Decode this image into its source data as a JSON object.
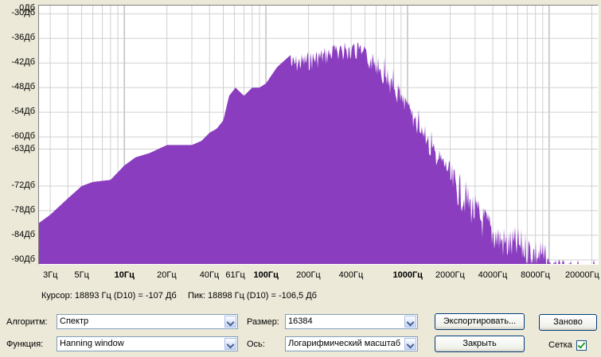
{
  "chart_data": {
    "type": "area",
    "y_axis": {
      "tick_labels": [
        "-30Дб",
        "-36Дб",
        "-42Дб",
        "-48Дб",
        "-54Дб",
        "-60Дб",
        "-63Дб",
        "-72Дб",
        "-78Дб",
        "-84Дб",
        "-90Дб"
      ],
      "tick_values": [
        -30,
        -36,
        -42,
        -48,
        -54,
        -60,
        -63,
        -72,
        -78,
        -84,
        -90
      ],
      "range": [
        -91,
        -28
      ],
      "partial_top_label": "0Дб"
    },
    "x_axis": {
      "scale": "log",
      "range_hz": [
        2.5,
        22050
      ],
      "tick_labels": [
        "3Гц",
        "5Гц",
        "10Гц",
        "20Гц",
        "40Гц",
        "61Гц",
        "100Гц",
        "200Гц",
        "400Гц",
        "1000Гц",
        "2000Гц",
        "4000Гц",
        "8000Гц",
        "20000Гц"
      ],
      "tick_values_hz": [
        3,
        5,
        10,
        20,
        40,
        61,
        100,
        200,
        400,
        1000,
        2000,
        4000,
        8000,
        20000
      ],
      "bold_labels": [
        "10Гц",
        "100Гц",
        "1000Гц"
      ]
    },
    "grid": true,
    "fill_color": "#8a3dbf",
    "spectrum_envelope": {
      "freq_hz": [
        2.5,
        3,
        4,
        5,
        6,
        8,
        10,
        12,
        15,
        20,
        25,
        30,
        35,
        40,
        45,
        50,
        55,
        61,
        70,
        80,
        90,
        100,
        120,
        150,
        200,
        250,
        300,
        350,
        400,
        450,
        500,
        600,
        700,
        800,
        1000,
        1200,
        1500,
        2000,
        2500,
        3000,
        4000,
        5000,
        6000,
        7000,
        8000,
        9000,
        10000,
        11000,
        20000,
        22050
      ],
      "db": [
        -81,
        -79,
        -75,
        -72,
        -71,
        -70.5,
        -67,
        -65,
        -64,
        -62,
        -62,
        -62,
        -61,
        -59,
        -58,
        -56,
        -50,
        -48,
        -50,
        -48,
        -48,
        -47,
        -43,
        -40,
        -39,
        -38,
        -37,
        -37,
        -36,
        -37,
        -38,
        -40,
        -43,
        -46,
        -51,
        -55,
        -61,
        -66,
        -70,
        -74,
        -79,
        -82,
        -82,
        -83,
        -84,
        -85,
        -88,
        -90,
        -90,
        -90
      ]
    }
  },
  "readout": {
    "cursor": "Курсор: 18893 Гц (D10) = -107 Дб",
    "peak": "Пик: 18898 Гц (D10) = -106,5 Дб"
  },
  "controls": {
    "algorithm_label": "Алгоритм:",
    "algorithm_value": "Спектр",
    "function_label": "Функция:",
    "function_value": "Hanning window",
    "size_label": "Размер:",
    "size_value": "16384",
    "axis_label": "Ось:",
    "axis_value": "Логарифмический масштаб",
    "export_button": "Экспортировать...",
    "replot_button": "Заново",
    "close_button": "Закрыть",
    "grid_label": "Сетка",
    "grid_checked": true
  }
}
